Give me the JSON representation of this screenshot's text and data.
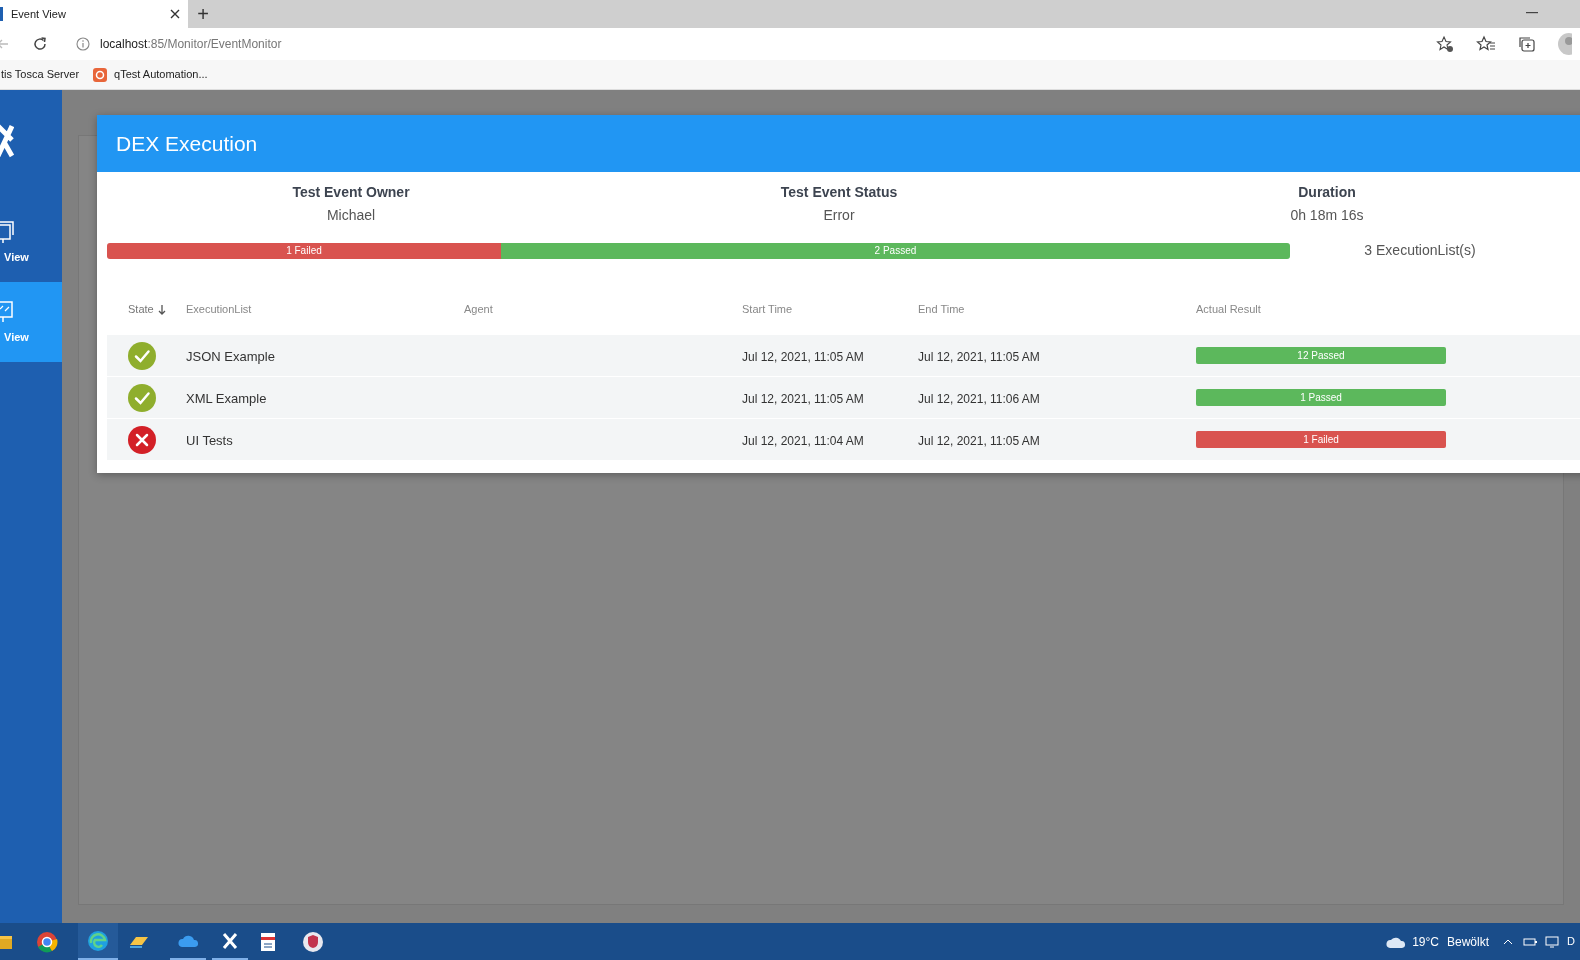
{
  "browser": {
    "tabs": [
      {
        "title": "Event View",
        "selected": true
      }
    ],
    "new_tab": "+",
    "address": {
      "host": "localhost",
      "path": ":85/Monitor/EventMonitor"
    },
    "bookmarks": [
      {
        "label": "tis Tosca Server",
        "kind": "plain"
      },
      {
        "label": "qTest Automation...",
        "kind": "qtest"
      }
    ]
  },
  "sidebar": {
    "items": [
      {
        "label": "View",
        "selected": false,
        "kind": "windows"
      },
      {
        "label": "View",
        "selected": true,
        "kind": "monitor"
      }
    ]
  },
  "dialog": {
    "title": "DEX Execution",
    "stats": [
      {
        "label": "Test Event Owner",
        "value": "Michael"
      },
      {
        "label": "Test Event Status",
        "value": "Error"
      },
      {
        "label": "Duration",
        "value": "0h 18m 16s"
      }
    ],
    "summary_bar": [
      {
        "label": "1 Failed",
        "kind": "failed",
        "level": 0.333
      },
      {
        "label": "2 Passed",
        "kind": "passed",
        "level": 0.667
      }
    ],
    "summary_count": "3 ExecutionList(s)",
    "table": {
      "columns": [
        {
          "label": "State",
          "sorted": true
        },
        {
          "label": "ExecutionList",
          "sorted": false
        },
        {
          "label": "Agent",
          "sorted": false
        },
        {
          "label": "Start Time",
          "sorted": false
        },
        {
          "label": "End Time",
          "sorted": false
        },
        {
          "label": "Actual Result",
          "sorted": false
        }
      ],
      "rows": [
        {
          "kind": "passed",
          "name": "JSON Example",
          "start": "Jul 12, 2021, 11:05 AM",
          "end": "Jul 12, 2021, 11:05 AM",
          "result": {
            "label": "12 Passed",
            "kind": "passed"
          }
        },
        {
          "kind": "passed",
          "name": "XML Example",
          "start": "Jul 12, 2021, 11:05 AM",
          "end": "Jul 12, 2021, 11:06 AM",
          "result": {
            "label": "1 Passed",
            "kind": "passed"
          }
        },
        {
          "kind": "failed",
          "name": "UI Tests",
          "start": "Jul 12, 2021, 11:04 AM",
          "end": "Jul 12, 2021, 11:05 AM",
          "result": {
            "label": "1 Failed",
            "kind": "failed"
          }
        }
      ]
    }
  },
  "taskbar": {
    "weather": "19°C",
    "condition": "Bewölkt",
    "language": "D"
  }
}
